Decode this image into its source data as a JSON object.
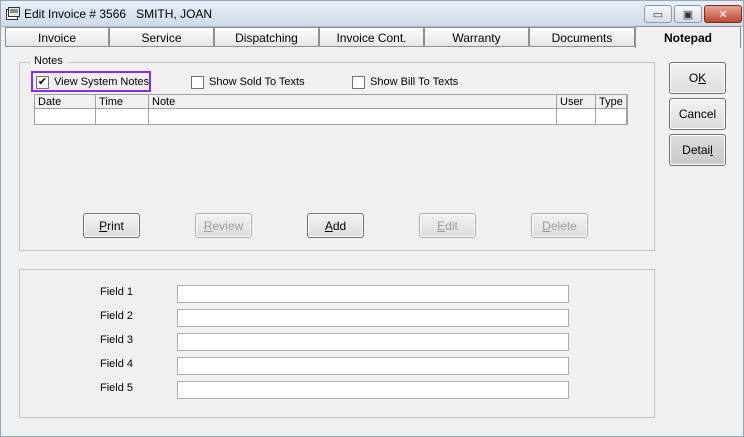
{
  "window": {
    "title": "Edit Invoice # 3566   SMITH, JOAN",
    "minimize_symbol": "▭",
    "maximize_symbol": "▣",
    "close_symbol": "✕"
  },
  "tabs": [
    {
      "label": "Invoice",
      "active": false
    },
    {
      "label": "Service",
      "active": false
    },
    {
      "label": "Dispatching",
      "active": false
    },
    {
      "label": "Invoice Cont.",
      "active": false
    },
    {
      "label": "Warranty",
      "active": false
    },
    {
      "label": "Documents",
      "active": false
    },
    {
      "label": "Notepad",
      "active": true
    }
  ],
  "notes": {
    "legend": "Notes",
    "view_system_notes": {
      "label": "View System Notes",
      "checked": true,
      "check_mark": "✔"
    },
    "show_sold_to_texts": {
      "label": "Show Sold To Texts",
      "checked": false
    },
    "show_bill_to_texts": {
      "label": "Show Bill To Texts",
      "checked": false
    },
    "columns": [
      "Date",
      "Time",
      "Note",
      "User",
      "Type"
    ],
    "buttons": {
      "print": {
        "pre": "",
        "key": "P",
        "post": "rint",
        "enabled": true
      },
      "review": {
        "pre": "",
        "key": "R",
        "post": "eview",
        "enabled": false
      },
      "add": {
        "pre": "",
        "key": "A",
        "post": "dd",
        "enabled": true
      },
      "edit": {
        "pre": "",
        "key": "E",
        "post": "dit",
        "enabled": false
      },
      "delete": {
        "pre": "",
        "key": "D",
        "post": "elete",
        "enabled": false
      }
    }
  },
  "fields": [
    {
      "label": "Field 1",
      "value": ""
    },
    {
      "label": "Field 2",
      "value": ""
    },
    {
      "label": "Field 3",
      "value": ""
    },
    {
      "label": "Field 4",
      "value": ""
    },
    {
      "label": "Field 5",
      "value": ""
    }
  ],
  "side_buttons": {
    "ok": {
      "pre": "O",
      "key": "K",
      "post": ""
    },
    "cancel": {
      "pre": "Cancel",
      "key": "",
      "post": ""
    },
    "detail": {
      "pre": "Detai",
      "key": "l",
      "post": ""
    }
  },
  "colors": {
    "highlight_border": "#8b2be2"
  }
}
